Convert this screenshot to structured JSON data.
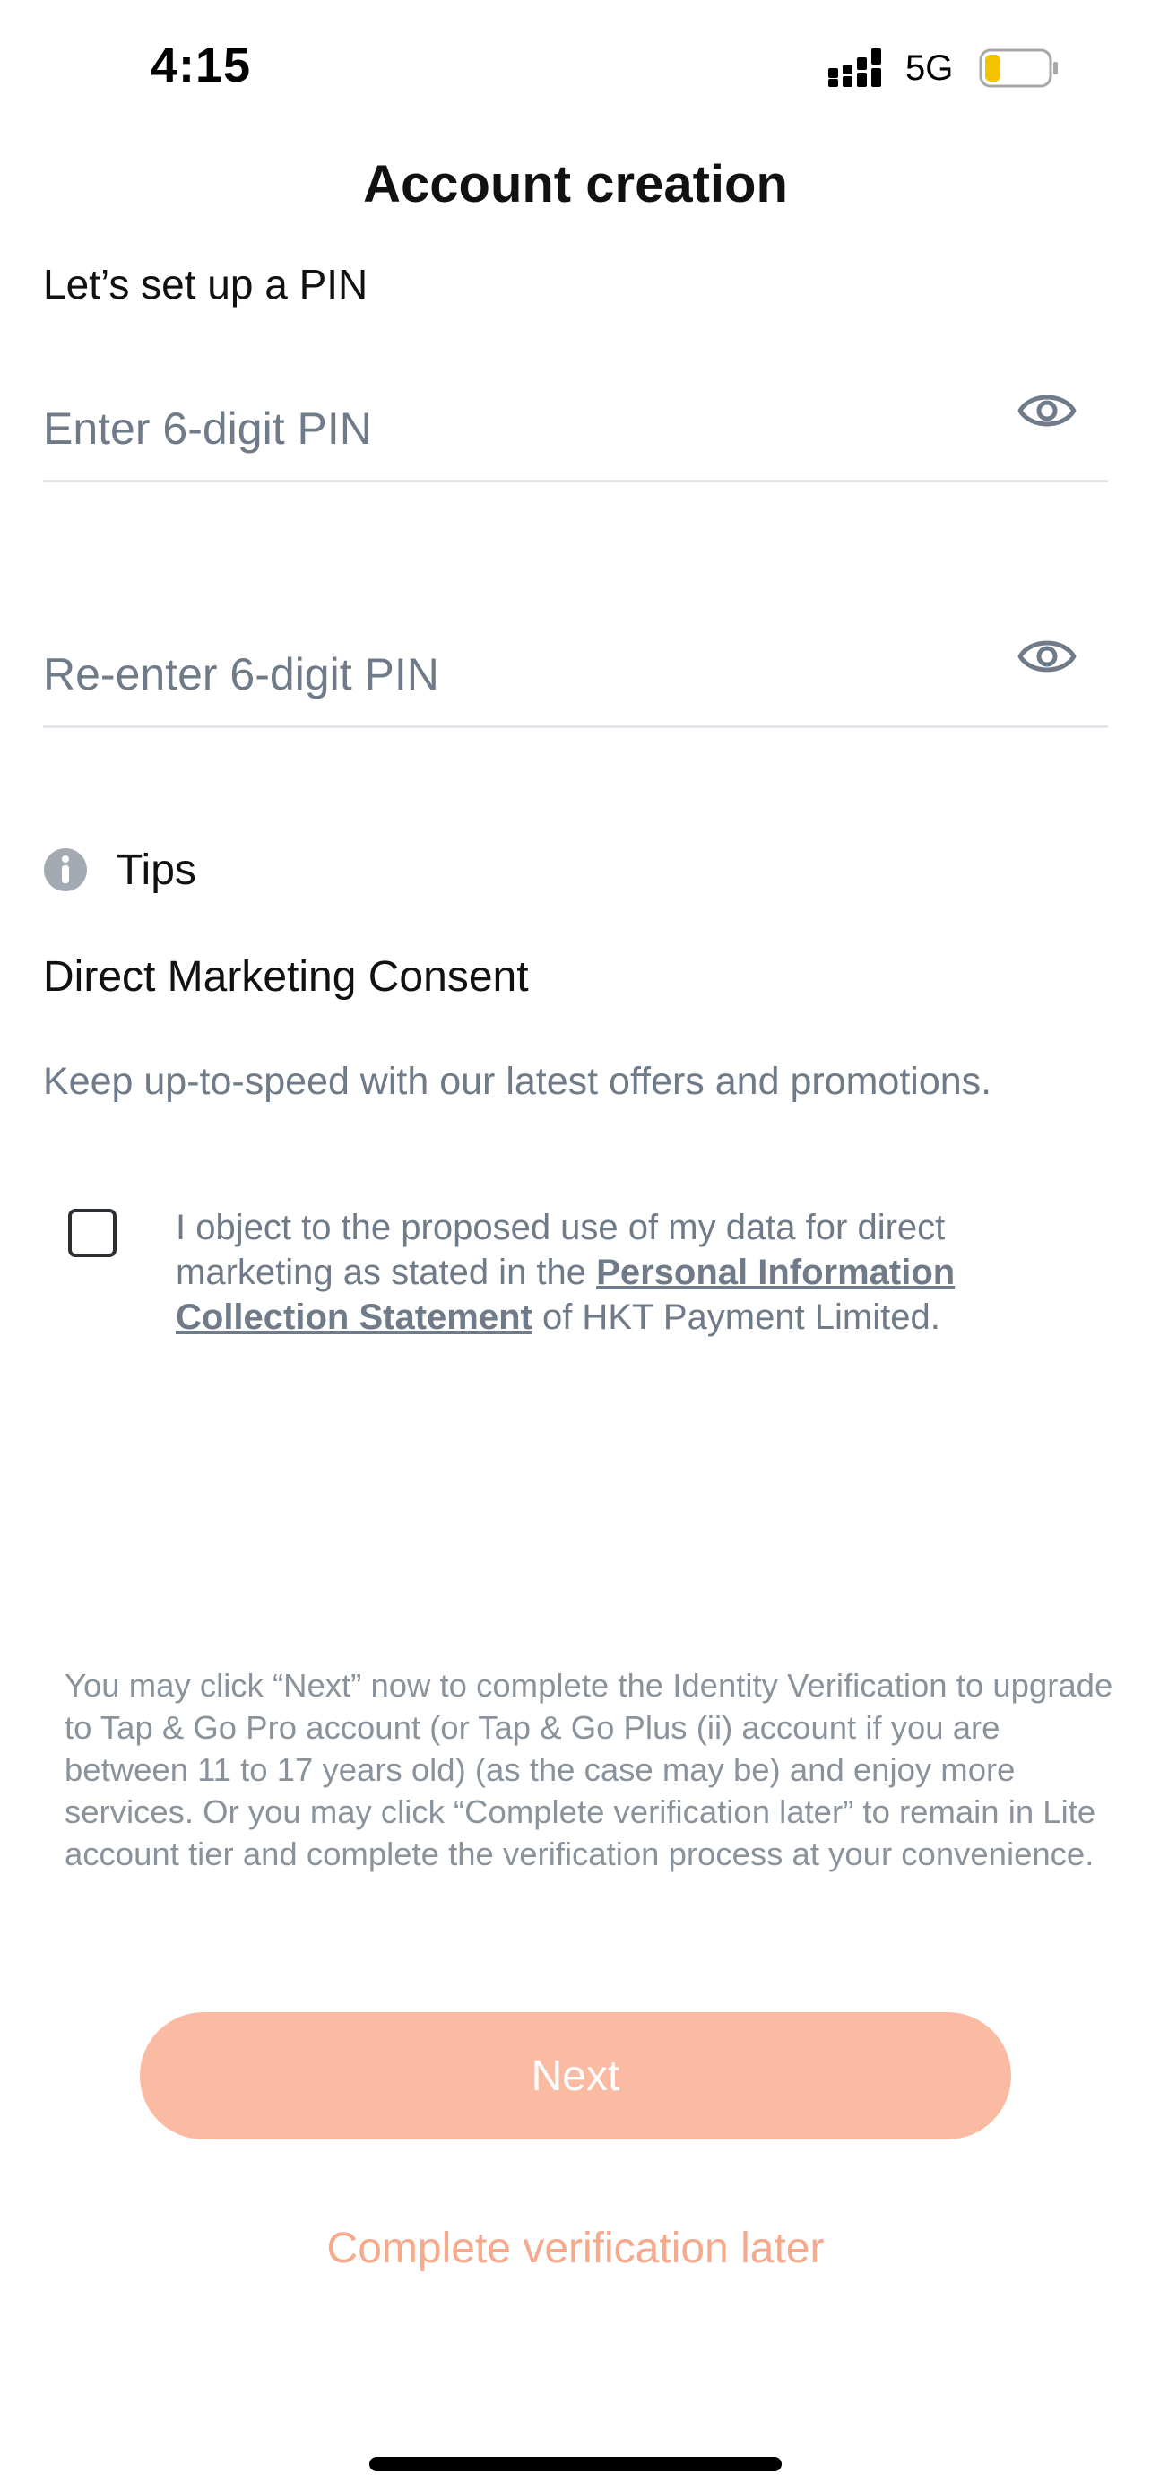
{
  "status_bar": {
    "time": "4:15",
    "network": "5G",
    "battery_level": 0.25,
    "battery_color": "#f5c400"
  },
  "header": {
    "title": "Account creation"
  },
  "pin_setup": {
    "subtitle": "Let’s set up a PIN",
    "pin_placeholder": "Enter 6-digit PIN",
    "pin_value": "",
    "confirm_placeholder": "Re-enter 6-digit PIN",
    "confirm_value": "",
    "toggle_icon": "eye-icon"
  },
  "tips": {
    "icon": "info-icon",
    "label": "Tips"
  },
  "direct_marketing": {
    "heading": "Direct Marketing Consent",
    "description": "Keep up-to-speed with our latest offers and promotions.",
    "checkbox_checked": false,
    "consent_prefix": "I object to the proposed use of my data for direct marketing as stated in the ",
    "consent_link": "Personal Information Collection Statement",
    "consent_suffix": " of HKT Payment Limited."
  },
  "info": {
    "text": "You may click “Next” now to complete the Identity Verification to upgrade to Tap & Go Pro account (or Tap & Go Plus (ii) account if you are between 11 to 17 years old) (as the case may be) and enjoy more services.  Or you may click “Complete verification later” to remain in Lite account tier and complete the verification process at your convenience."
  },
  "actions": {
    "next_label": "Next",
    "later_label": "Complete verification later",
    "accent_color": "#fbbba2"
  }
}
